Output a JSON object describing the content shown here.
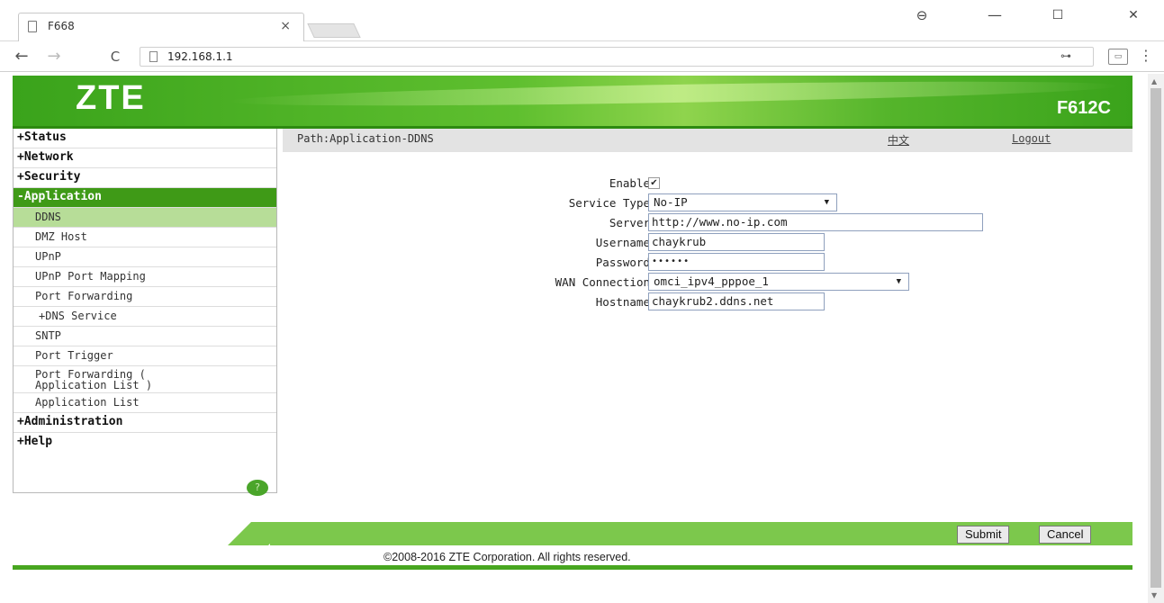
{
  "browser": {
    "tab_title": "F668",
    "tab_close": "×",
    "url": "192.168.1.1",
    "window_controls": {
      "minimize": "—",
      "maximize": "☐",
      "close": "✕",
      "profile": "⊖"
    },
    "nav": {
      "back": "←",
      "forward": "→",
      "reload": "C"
    },
    "icons": [
      "page-icon",
      "key-icon",
      "cast-icon",
      "menu-icon"
    ]
  },
  "header": {
    "logo": "ZTE",
    "model": "F612C"
  },
  "sidebar": {
    "items": [
      {
        "label": "+Status",
        "level": "top"
      },
      {
        "label": "+Network",
        "level": "top"
      },
      {
        "label": "+Security",
        "level": "top"
      },
      {
        "label": "-Application",
        "level": "top",
        "active": true
      },
      {
        "label": "DDNS",
        "level": "sub",
        "selected": true
      },
      {
        "label": "DMZ Host",
        "level": "sub"
      },
      {
        "label": "UPnP",
        "level": "sub"
      },
      {
        "label": "UPnP Port Mapping",
        "level": "sub"
      },
      {
        "label": "Port Forwarding",
        "level": "sub"
      },
      {
        "label": "+DNS Service",
        "level": "sub"
      },
      {
        "label": "SNTP",
        "level": "sub"
      },
      {
        "label": "Port Trigger",
        "level": "sub"
      },
      {
        "label": "Port Forwarding (",
        "label2": "Application List )",
        "level": "sub"
      },
      {
        "label": "Application List",
        "level": "sub"
      },
      {
        "label": "+Administration",
        "level": "top"
      },
      {
        "label": "+Help",
        "level": "top"
      }
    ],
    "help_icon": "?"
  },
  "pathbar": {
    "path": "Path:Application-DDNS",
    "lang": "中文",
    "logout": "Logout"
  },
  "form": {
    "enable_label": "Enable",
    "enable_checked": true,
    "check_mark": "✔",
    "service_type_label": "Service Type",
    "service_type_value": "No-IP",
    "server_label": "Server",
    "server_value": "http://www.no-ip.com",
    "username_label": "Username",
    "username_value": "chaykrub",
    "password_label": "Password",
    "password_value": "••••••",
    "wan_label": "WAN Connection",
    "wan_value": "omci_ipv4_pppoe_1",
    "hostname_label": "Hostname",
    "hostname_value": "chaykrub2.ddns.net",
    "dropdown_arrow": "▼"
  },
  "actions": {
    "submit": "Submit",
    "cancel": "Cancel"
  },
  "footer": {
    "copyright": "©2008-2016 ZTE Corporation. All rights reserved."
  },
  "colors": {
    "brand_green": "#3f9a17",
    "selected_item": "#b7dd98",
    "pathbar": "#e3e3e3"
  }
}
